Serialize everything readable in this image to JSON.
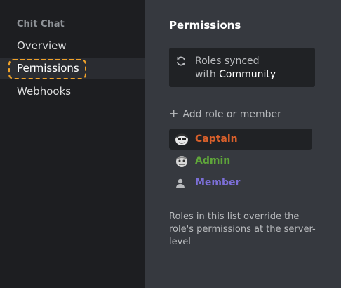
{
  "sidebar": {
    "header": "Chit Chat",
    "items": [
      {
        "label": "Overview"
      },
      {
        "label": "Permissions"
      },
      {
        "label": "Webhooks"
      }
    ]
  },
  "main": {
    "title": "Permissions",
    "sync": {
      "icon": "sync-icon",
      "line1": "Roles synced",
      "line2_prefix": "with ",
      "line2_target": "Community"
    },
    "add_role": {
      "icon": "plus-icon",
      "label": "Add role or member"
    },
    "roles": [
      {
        "name": "Captain",
        "color": "#d9602b",
        "avatar": "cartoon-avatar"
      },
      {
        "name": "Admin",
        "color": "#5fa63a",
        "avatar": "cartoon-avatar"
      },
      {
        "name": "Member",
        "color": "#7c6fd8",
        "avatar": "person-icon"
      }
    ],
    "info": "Roles in this list override the role's permissions at the server-level"
  },
  "colors": {
    "focus_ring": "#f0a22a",
    "sidebar_bg": "#1d1e21",
    "main_bg": "#36393f"
  }
}
